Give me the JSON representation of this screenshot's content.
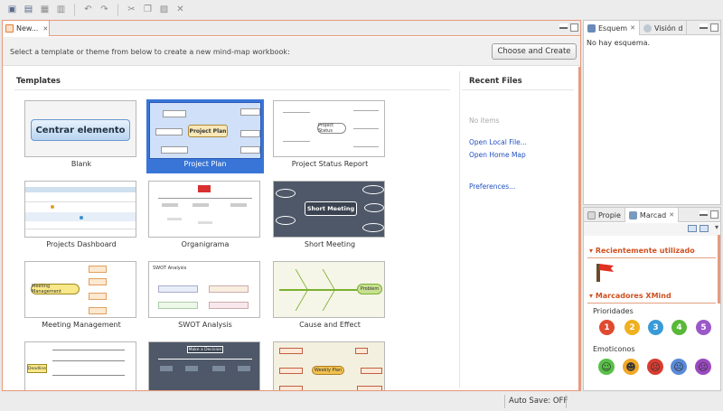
{
  "toolbar": {
    "icons": [
      "new-icon",
      "open-icon",
      "save-icon",
      "print-icon",
      "undo-icon",
      "redo-icon",
      "cut-icon",
      "copy-icon",
      "paste-icon",
      "delete-icon"
    ]
  },
  "editor": {
    "tab_label": "New...",
    "prompt": "Select a template or theme from below to create a new mind-map workbook:",
    "choose_button": "Choose and Create",
    "templates_title": "Templates",
    "templates": [
      {
        "label": "Blank",
        "thumb_text": "Centrar elemento"
      },
      {
        "label": "Project Plan",
        "thumb_text": "Project Plan"
      },
      {
        "label": "Project Status Report",
        "thumb_text": "Project Status"
      },
      {
        "label": "Projects Dashboard"
      },
      {
        "label": "Organigrama"
      },
      {
        "label": "Short Meeting",
        "thumb_text": "Short Meeting"
      },
      {
        "label": "Meeting Management",
        "thumb_text": "Meeting Management"
      },
      {
        "label": "SWOT Analysis",
        "thumb_text": "SWOT Analysis"
      },
      {
        "label": "Cause and Effect",
        "thumb_text": "Problem"
      },
      {
        "label": "",
        "thumb_text": "Deadline"
      },
      {
        "label": "",
        "thumb_text": "Make a Decision"
      },
      {
        "label": "",
        "thumb_text": "Weekly Plan"
      }
    ],
    "recent_title": "Recent Files",
    "recent_empty": "No items",
    "links": {
      "open_local": "Open Local File...",
      "open_home": "Open Home Map",
      "preferences": "Preferences..."
    }
  },
  "outline": {
    "tab_esquema": "Esquem",
    "tab_vision": "Visión d",
    "empty": "No hay esquema."
  },
  "markers": {
    "tab_props": "Propie",
    "tab_marcad": "Marcad",
    "recent_header": "Recientemente utilizado",
    "xmind_header": "Marcadores XMind",
    "priorities_label": "Prioridades",
    "priorities": [
      "1",
      "2",
      "3",
      "4",
      "5"
    ],
    "priority_colors": [
      "#e04a30",
      "#f0b020",
      "#3a9ad8",
      "#58b838",
      "#9a58c8"
    ],
    "emoticons_label": "Emoticonos"
  },
  "status": {
    "autosave": "Auto Save: OFF"
  }
}
